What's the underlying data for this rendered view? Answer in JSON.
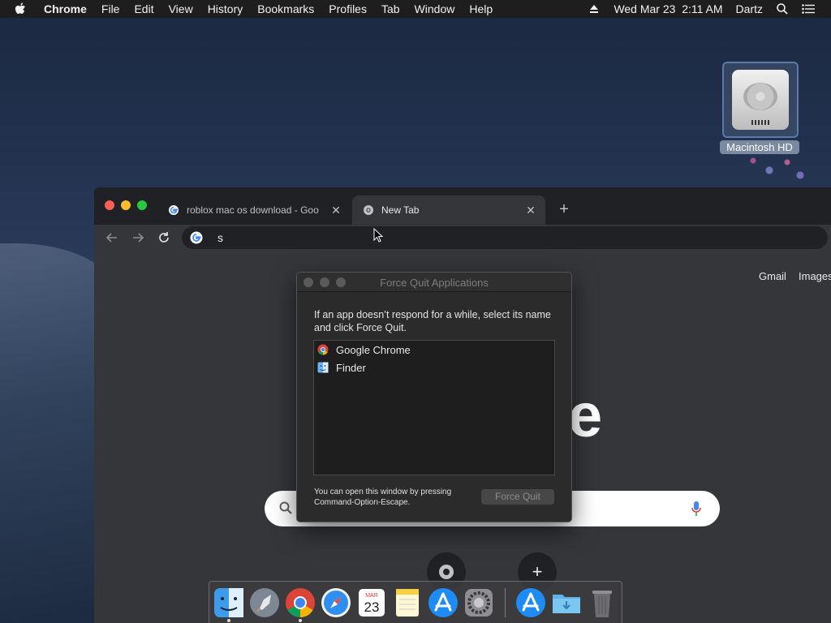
{
  "menubar": {
    "app": "Chrome",
    "items": [
      "File",
      "Edit",
      "View",
      "History",
      "Bookmarks",
      "Profiles",
      "Tab",
      "Window",
      "Help"
    ],
    "clock": "Wed Mar 23  2:11 AM",
    "user": "Dartz"
  },
  "desktop": {
    "disk_label": "Macintosh HD"
  },
  "chrome": {
    "tabs": [
      {
        "title": "roblox mac os download - Goo",
        "favicon": "google-g-icon"
      },
      {
        "title": "New Tab",
        "favicon": "chrome-icon"
      }
    ],
    "omnibox_value": "s",
    "links": {
      "gmail": "Gmail",
      "images": "Images"
    },
    "logo_fragment": "e"
  },
  "force_quit": {
    "title": "Force Quit Applications",
    "instructions": "If an app doesn’t respond for a while, select its name and click Force Quit.",
    "apps": [
      {
        "name": "Google Chrome",
        "icon": "chrome-icon"
      },
      {
        "name": "Finder",
        "icon": "finder-icon"
      }
    ],
    "footer": "You can open this window by pressing Command-Option-Escape.",
    "button": "Force Quit"
  },
  "dock": {
    "calendar_month": "MAR",
    "calendar_day": "23",
    "apps": [
      "finder-icon",
      "launchpad-icon",
      "chrome-icon",
      "safari-icon",
      "calendar-icon",
      "notes-icon",
      "app-store-icon",
      "system-preferences-icon",
      "app-store-icon",
      "downloads-folder-icon",
      "trash-icon"
    ]
  }
}
